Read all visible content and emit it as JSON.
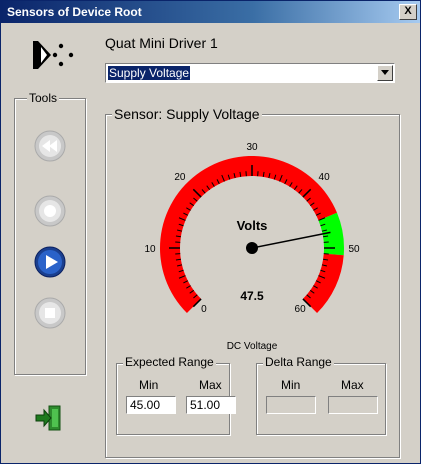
{
  "window": {
    "title": "Sensors of Device Root",
    "close_glyph": "X"
  },
  "device": {
    "name": "Quat Mini Driver 1"
  },
  "sensor_select": {
    "value": "Supply Voltage"
  },
  "tools": {
    "label": "Tools",
    "items": [
      {
        "name": "rewind",
        "icon": "rewind-icon"
      },
      {
        "name": "record",
        "icon": "record-icon"
      },
      {
        "name": "play",
        "icon": "play-icon"
      },
      {
        "name": "stop",
        "icon": "stop-icon"
      }
    ]
  },
  "sensor": {
    "group_label": "Sensor: Supply Voltage",
    "gauge": {
      "unit": "Volts",
      "value_text": "47.5",
      "value": 47.5,
      "caption": "DC Voltage",
      "min": 0,
      "max": 60,
      "tick_labels": [
        "0",
        "10",
        "20",
        "30",
        "40",
        "50",
        "60"
      ],
      "ok_range": [
        45,
        51
      ],
      "colors": {
        "alarm": "#ff0000",
        "ok": "#00ff00"
      }
    }
  },
  "expected_range": {
    "label": "Expected Range",
    "min_label": "Min",
    "max_label": "Max",
    "min": "45.00",
    "max": "51.00"
  },
  "delta_range": {
    "label": "Delta Range",
    "min_label": "Min",
    "max_label": "Max",
    "min": "",
    "max": ""
  }
}
